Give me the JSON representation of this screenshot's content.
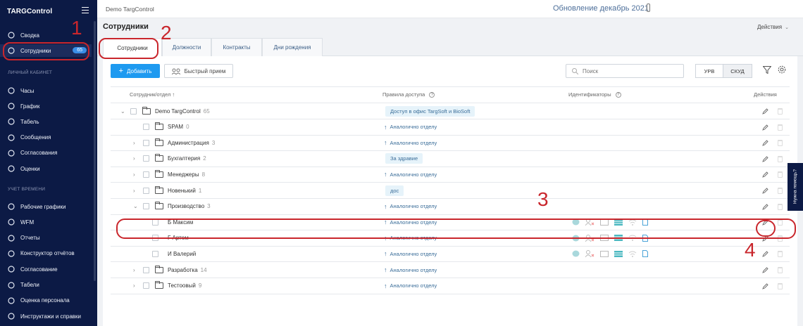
{
  "sidebar": {
    "logo": "TARGControl",
    "top_items": [
      {
        "label": "Сводка",
        "icon": "dashboard-icon"
      },
      {
        "label": "Сотрудники",
        "icon": "users-icon",
        "badge": "65"
      }
    ],
    "section_personal": "ЛИЧНЫЙ КАБИНЕТ",
    "personal_items": [
      {
        "label": "Часы",
        "icon": "clock-icon"
      },
      {
        "label": "График",
        "icon": "calendar-icon"
      },
      {
        "label": "Табель",
        "icon": "timesheet-icon"
      },
      {
        "label": "Сообщения",
        "icon": "messages-icon"
      },
      {
        "label": "Согласования",
        "icon": "approvals-icon"
      },
      {
        "label": "Оценки",
        "icon": "star-icon"
      }
    ],
    "section_time": "УЧЕТ ВРЕМЕНИ",
    "time_items": [
      {
        "label": "Рабочие графики",
        "icon": "schedule-icon"
      },
      {
        "label": "WFM",
        "icon": "wfm-icon"
      },
      {
        "label": "Отчеты",
        "icon": "reports-icon"
      },
      {
        "label": "Конструктор отчётов",
        "icon": "report-builder-icon"
      },
      {
        "label": "Согласование",
        "icon": "approval-icon"
      },
      {
        "label": "Табели",
        "icon": "timesheets-icon"
      },
      {
        "label": "Оценка персонала",
        "icon": "evaluation-icon"
      },
      {
        "label": "Инструктажи и справки",
        "icon": "briefing-icon"
      }
    ]
  },
  "topbar": {
    "title": "Demo TargControl",
    "update": "Обновление декабрь 2021"
  },
  "page": {
    "title": "Сотрудники",
    "actions": "Действия"
  },
  "tabs": [
    "Сотрудники",
    "Должности",
    "Контракты",
    "Дни рождения"
  ],
  "toolbar": {
    "add": "Добавить",
    "quick": "Быстрый прием",
    "search_placeholder": "Поиск",
    "toggle_urv": "УРВ",
    "toggle_skud": "СКУД"
  },
  "table": {
    "headers": {
      "employee": "Сотрудник/отдел ↑",
      "rules": "Правила доступа",
      "ids": "Идентификаторы",
      "actions": "Действия"
    },
    "rows": [
      {
        "name": "Demo TargControl",
        "count": "65",
        "rule": "Доступ в офис TargSoft и BioSoft",
        "rule_type": "tag",
        "chev": "down"
      },
      {
        "name": "SPAM",
        "count": "0",
        "rule": "Аналогично отделу",
        "rule_type": "inherit",
        "chev": ""
      },
      {
        "name": "Администрация",
        "count": "3",
        "rule": "Аналогично отделу",
        "rule_type": "inherit",
        "chev": "right"
      },
      {
        "name": "Бухгалтерия",
        "count": "2",
        "rule": "За здравие",
        "rule_type": "tag",
        "chev": "right"
      },
      {
        "name": "Менеджеры",
        "count": "8",
        "rule": "Аналогично отделу",
        "rule_type": "inherit",
        "chev": "right"
      },
      {
        "name": "Новенький",
        "count": "1",
        "rule": "дос",
        "rule_type": "tag",
        "chev": "right"
      },
      {
        "name": "Производство",
        "count": "3",
        "rule": "Аналогично отделу",
        "rule_type": "inherit",
        "chev": "down"
      },
      {
        "name": "Б Максим",
        "count": "",
        "rule": "Аналогично отделу",
        "rule_type": "inherit",
        "employee": true
      },
      {
        "name": "Г Артем",
        "count": "",
        "rule": "Аналогично отделу",
        "rule_type": "inherit",
        "employee": true
      },
      {
        "name": "И Валерий",
        "count": "",
        "rule": "Аналогично отделу",
        "rule_type": "inherit",
        "employee": true
      },
      {
        "name": "Разработка",
        "count": "14",
        "rule": "Аналогично отделу",
        "rule_type": "inherit",
        "chev": "right"
      },
      {
        "name": "Тестоовый",
        "count": "9",
        "rule": "Аналогично отделу",
        "rule_type": "inherit",
        "chev": "right"
      }
    ]
  },
  "annotations": [
    "1",
    "2",
    "3",
    "4"
  ],
  "help": "Нужна помощь?",
  "colors": {
    "sidebar": "#0c1a45",
    "accent": "#1e9af0",
    "annotation": "#c9262c",
    "badge": "#3a8ee6"
  }
}
